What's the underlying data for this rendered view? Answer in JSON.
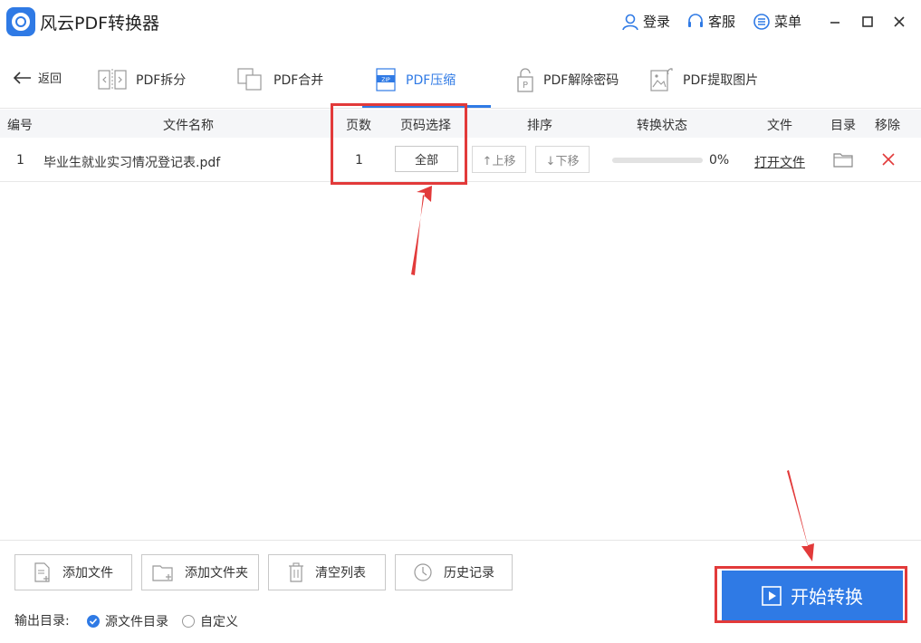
{
  "app": {
    "title": "风云PDF转换器"
  },
  "titlebar": {
    "login": "登录",
    "service": "客服",
    "menu": "菜单"
  },
  "nav": {
    "back": "返回",
    "tabs": [
      {
        "label": "PDF拆分",
        "icon": "split-icon"
      },
      {
        "label": "PDF合并",
        "icon": "merge-icon"
      },
      {
        "label": "PDF压缩",
        "icon": "zip-icon",
        "active": true
      },
      {
        "label": "PDF解除密码",
        "icon": "unlock-icon"
      },
      {
        "label": "PDF提取图片",
        "icon": "image-extract-icon"
      }
    ]
  },
  "table": {
    "headers": {
      "index": "编号",
      "filename": "文件名称",
      "pages": "页数",
      "page_select": "页码选择",
      "order": "排序",
      "status": "转换状态",
      "file": "文件",
      "dir": "目录",
      "remove": "移除"
    },
    "rows": [
      {
        "index": "1",
        "filename": "毕业生就业实习情况登记表.pdf",
        "pages": "1",
        "page_select": "全部",
        "move_up": "↑上移",
        "move_down": "↓下移",
        "progress": 0,
        "progress_text": "0%",
        "open_file": "打开文件"
      }
    ]
  },
  "footer": {
    "add_file": "添加文件",
    "add_folder": "添加文件夹",
    "clear_list": "清空列表",
    "history": "历史记录",
    "output_label": "输出目录:",
    "output_options": [
      {
        "label": "源文件目录",
        "selected": true
      },
      {
        "label": "自定义",
        "selected": false
      }
    ],
    "start": "开始转换"
  },
  "colors": {
    "accent": "#2f7ae5",
    "annotation": "#e23a3a",
    "remove": "#e23a3a"
  }
}
